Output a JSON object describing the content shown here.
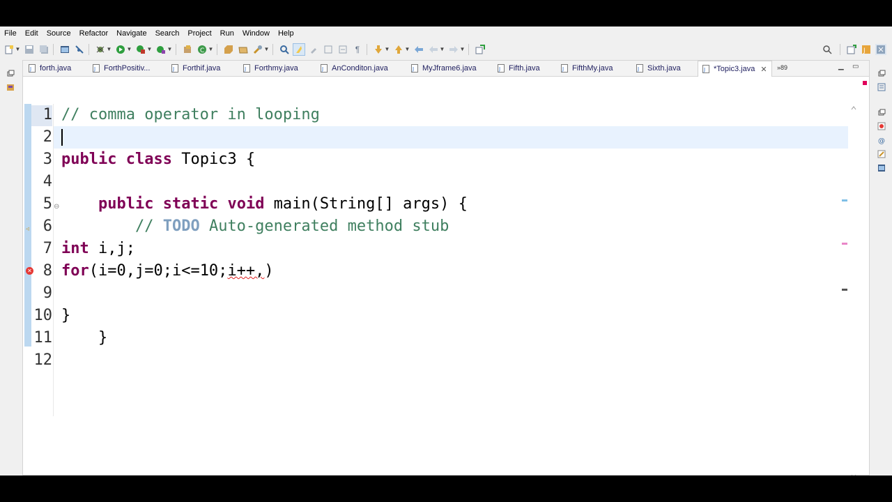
{
  "menu": [
    "File",
    "Edit",
    "Source",
    "Refactor",
    "Navigate",
    "Search",
    "Project",
    "Run",
    "Window",
    "Help"
  ],
  "tabs": [
    {
      "label": "forth.java",
      "active": false
    },
    {
      "label": "ForthPositiv...",
      "active": false
    },
    {
      "label": "Forthif.java",
      "active": false
    },
    {
      "label": "Forthmy.java",
      "active": false
    },
    {
      "label": "AnConditon.java",
      "active": false
    },
    {
      "label": "MyJframe6.java",
      "active": false
    },
    {
      "label": "Fifth.java",
      "active": false
    },
    {
      "label": "FifthMy.java",
      "active": false
    },
    {
      "label": "Sixth.java",
      "active": false
    },
    {
      "label": "*Topic3.java",
      "active": true
    }
  ],
  "tab_overflow": "»89",
  "editor": {
    "line_numbers": [
      "1",
      "2",
      "3",
      "4",
      "5",
      "6",
      "7",
      "8",
      "9",
      "10",
      "11",
      "12"
    ],
    "lines": {
      "l1": "// comma operator in looping",
      "l3_kw1": "public",
      "l3_kw2": "class",
      "l3_rest": " Topic3 {",
      "l5_indent": "    ",
      "l5_kw1": "public",
      "l5_kw2": "static",
      "l5_kw3": "void",
      "l5_rest": " main(String[] args) {",
      "l6_indent": "        ",
      "l6_comment1": "// ",
      "l6_todo": "TODO",
      "l6_comment2": " Auto-generated method stub",
      "l7_kw": "int",
      "l7_rest": " i,j;",
      "l8_kw": "for",
      "l8_pre": "(i=0,j=0;i<=10;",
      "l8_err": "i++,",
      "l8_post": ")",
      "l10": "}",
      "l11": "    }"
    }
  },
  "colors": {
    "keyword": "#7f0055",
    "comment": "#3f7f5f",
    "todo": "#7f9fbf",
    "error": "#e53935",
    "current_line": "#e8f2fe"
  },
  "icons": [
    "new-icon",
    "save-icon",
    "save-all-icon",
    "terminal-icon",
    "skip-breakpoints-icon",
    "debug-icon",
    "run-icon",
    "coverage-icon",
    "external-tools-icon",
    "new-java-package-icon",
    "new-java-class-icon",
    "open-type-icon",
    "open-task-icon",
    "search-icon",
    "toggle-mark-occurrences-icon",
    "show-whitespace-icon",
    "next-annotation-icon",
    "previous-annotation-icon",
    "back-icon",
    "forward-icon",
    "pin-editor-icon",
    "quick-access-search-icon",
    "open-perspective-icon",
    "java-perspective-icon",
    "debug-perspective-icon"
  ]
}
